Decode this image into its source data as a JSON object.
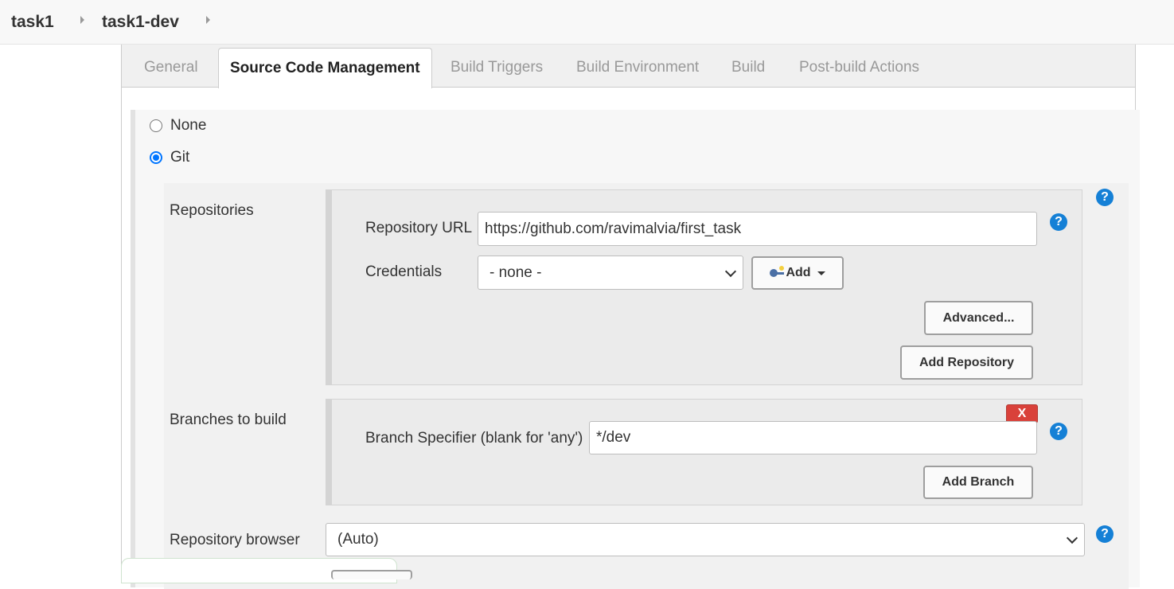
{
  "breadcrumb": {
    "items": [
      "task1",
      "task1-dev"
    ]
  },
  "tabs": [
    {
      "label": "General",
      "active": false
    },
    {
      "label": "Source Code Management",
      "active": true
    },
    {
      "label": "Build Triggers",
      "active": false
    },
    {
      "label": "Build Environment",
      "active": false
    },
    {
      "label": "Build",
      "active": false
    },
    {
      "label": "Post-build Actions",
      "active": false
    }
  ],
  "scm": {
    "options": [
      {
        "label": "None",
        "checked": false
      },
      {
        "label": "Git",
        "checked": true
      }
    ]
  },
  "git": {
    "repositories_label": "Repositories",
    "repository_url_label": "Repository URL",
    "repository_url_value": "https://github.com/ravimalvia/first_task",
    "credentials_label": "Credentials",
    "credentials_value": "- none -",
    "add_label": "Add",
    "advanced_label": "Advanced...",
    "add_repository_label": "Add Repository",
    "branches_label": "Branches to build",
    "branch_specifier_label": "Branch Specifier (blank for 'any')",
    "branch_specifier_value": "*/dev",
    "delete_label": "X",
    "add_branch_label": "Add Branch",
    "repo_browser_label": "Repository browser",
    "repo_browser_value": "(Auto)"
  },
  "help_symbol": "?",
  "colors": {
    "help": "#1580d6",
    "delete": "#d9413a",
    "radio_active": "#0075ff"
  }
}
